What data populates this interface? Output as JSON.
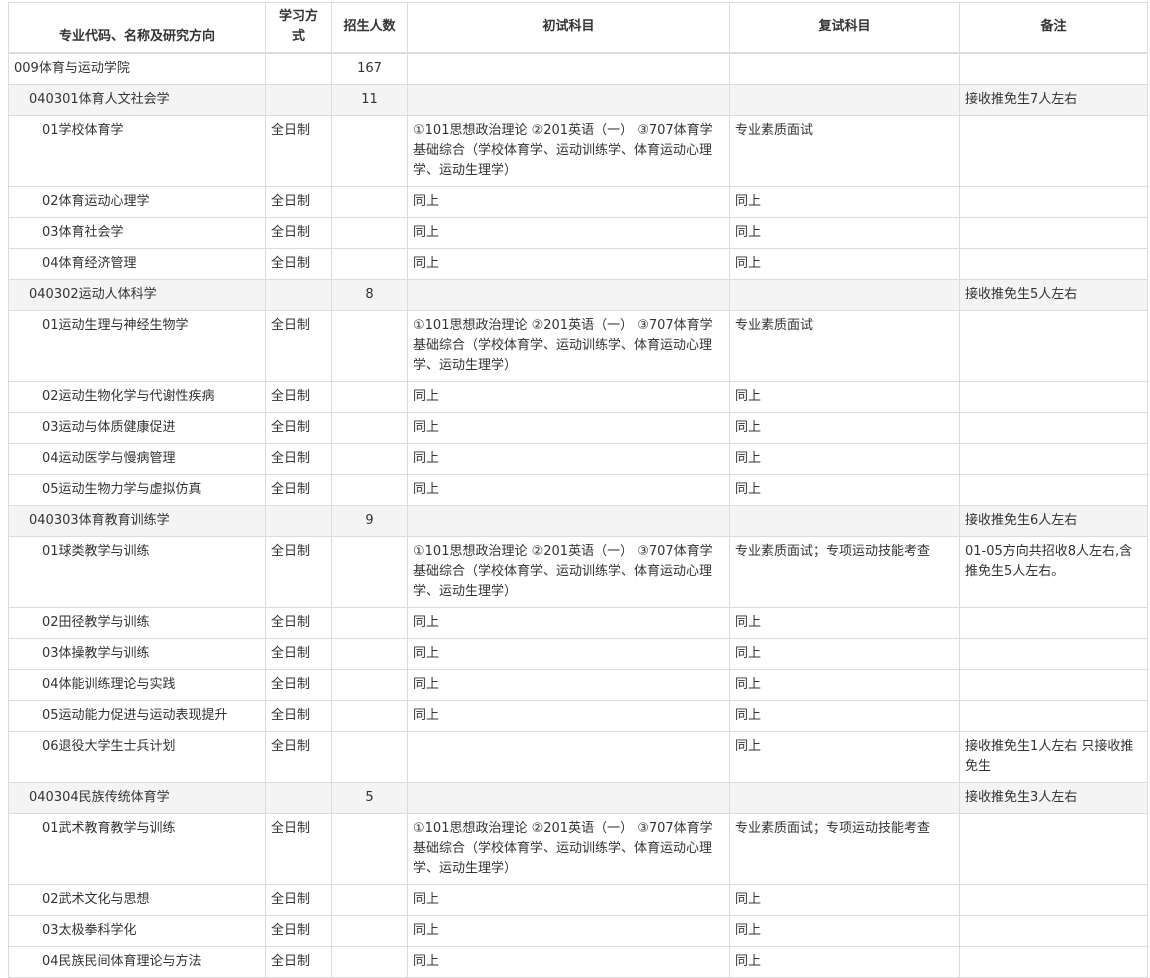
{
  "headers": {
    "major": "专业代码、名称及研究方向",
    "study_mode": "学习方式",
    "enrollment": "招生人数",
    "exam_subjects": "初试科目",
    "retest_subjects": "复试科目",
    "notes": "备注"
  },
  "rows": [
    {
      "kind": "college",
      "name": "009体育与运动学院",
      "mode": "",
      "count": "167",
      "exam": "",
      "retest": "",
      "note": ""
    },
    {
      "kind": "major",
      "name": "040301体育人文社会学",
      "mode": "",
      "count": "11",
      "exam": "",
      "retest": "",
      "note": "接收推免生7人左右"
    },
    {
      "kind": "dir",
      "name": "01学校体育学",
      "mode": "全日制",
      "count": "",
      "exam": "①101思想政治理论 ②201英语（一） ③707体育学基础综合（学校体育学、运动训练学、体育运动心理学、运动生理学）",
      "retest": "专业素质面试",
      "note": ""
    },
    {
      "kind": "dir",
      "name": "02体育运动心理学",
      "mode": "全日制",
      "count": "",
      "exam": "同上",
      "retest": "同上",
      "note": ""
    },
    {
      "kind": "dir",
      "name": "03体育社会学",
      "mode": "全日制",
      "count": "",
      "exam": "同上",
      "retest": "同上",
      "note": ""
    },
    {
      "kind": "dir",
      "name": "04体育经济管理",
      "mode": "全日制",
      "count": "",
      "exam": "同上",
      "retest": "同上",
      "note": ""
    },
    {
      "kind": "major",
      "name": "040302运动人体科学",
      "mode": "",
      "count": "8",
      "exam": "",
      "retest": "",
      "note": "接收推免生5人左右"
    },
    {
      "kind": "dir",
      "name": "01运动生理与神经生物学",
      "mode": "全日制",
      "count": "",
      "exam": "①101思想政治理论 ②201英语（一） ③707体育学基础综合（学校体育学、运动训练学、体育运动心理学、运动生理学）",
      "retest": "专业素质面试",
      "note": ""
    },
    {
      "kind": "dir",
      "name": "02运动生物化学与代谢性疾病",
      "mode": "全日制",
      "count": "",
      "exam": "同上",
      "retest": "同上",
      "note": ""
    },
    {
      "kind": "dir",
      "name": "03运动与体质健康促进",
      "mode": "全日制",
      "count": "",
      "exam": "同上",
      "retest": "同上",
      "note": ""
    },
    {
      "kind": "dir",
      "name": "04运动医学与慢病管理",
      "mode": "全日制",
      "count": "",
      "exam": "同上",
      "retest": "同上",
      "note": ""
    },
    {
      "kind": "dir",
      "name": "05运动生物力学与虚拟仿真",
      "mode": "全日制",
      "count": "",
      "exam": "同上",
      "retest": "同上",
      "note": ""
    },
    {
      "kind": "major",
      "name": "040303体育教育训练学",
      "mode": "",
      "count": "9",
      "exam": "",
      "retest": "",
      "note": "接收推免生6人左右"
    },
    {
      "kind": "dir",
      "name": "01球类教学与训练",
      "mode": "全日制",
      "count": "",
      "exam": "①101思想政治理论 ②201英语（一） ③707体育学基础综合（学校体育学、运动训练学、体育运动心理学、运动生理学）",
      "retest": "专业素质面试；专项运动技能考查",
      "note": "01-05方向共招收8人左右,含推免生5人左右。"
    },
    {
      "kind": "dir",
      "name": "02田径教学与训练",
      "mode": "全日制",
      "count": "",
      "exam": "同上",
      "retest": "同上",
      "note": ""
    },
    {
      "kind": "dir",
      "name": "03体操教学与训练",
      "mode": "全日制",
      "count": "",
      "exam": "同上",
      "retest": "同上",
      "note": ""
    },
    {
      "kind": "dir",
      "name": "04体能训练理论与实践",
      "mode": "全日制",
      "count": "",
      "exam": "同上",
      "retest": "同上",
      "note": ""
    },
    {
      "kind": "dir",
      "name": "05运动能力促进与运动表现提升",
      "mode": "全日制",
      "count": "",
      "exam": "同上",
      "retest": "同上",
      "note": ""
    },
    {
      "kind": "dir",
      "name": "06退役大学生士兵计划",
      "mode": "全日制",
      "count": "",
      "exam": "",
      "retest": "同上",
      "note": "接收推免生1人左右 只接收推免生"
    },
    {
      "kind": "major",
      "name": "040304民族传统体育学",
      "mode": "",
      "count": "5",
      "exam": "",
      "retest": "",
      "note": "接收推免生3人左右"
    },
    {
      "kind": "dir",
      "name": "01武术教育教学与训练",
      "mode": "全日制",
      "count": "",
      "exam": "①101思想政治理论 ②201英语（一） ③707体育学基础综合（学校体育学、运动训练学、体育运动心理学、运动生理学）",
      "retest": "专业素质面试；专项运动技能考查",
      "note": ""
    },
    {
      "kind": "dir",
      "name": "02武术文化与思想",
      "mode": "全日制",
      "count": "",
      "exam": "同上",
      "retest": "同上",
      "note": ""
    },
    {
      "kind": "dir",
      "name": "03太极拳科学化",
      "mode": "全日制",
      "count": "",
      "exam": "同上",
      "retest": "同上",
      "note": ""
    },
    {
      "kind": "dir",
      "name": "04民族民间体育理论与方法",
      "mode": "全日制",
      "count": "",
      "exam": "同上",
      "retest": "同上",
      "note": ""
    }
  ]
}
